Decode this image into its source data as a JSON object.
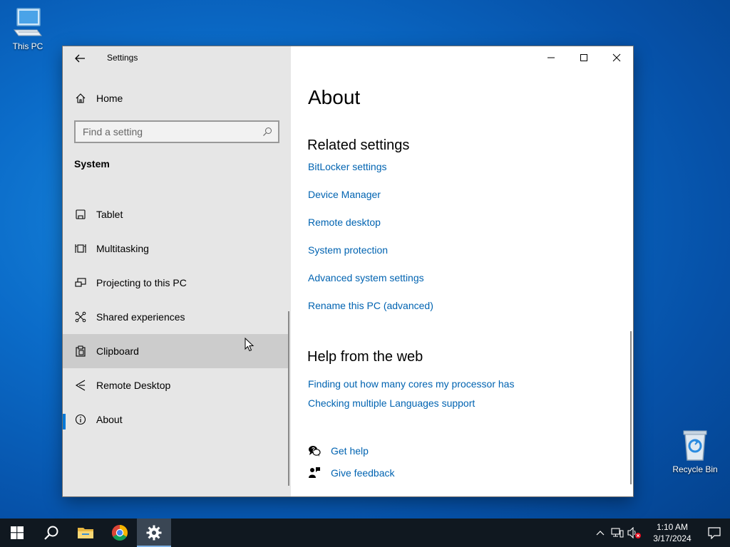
{
  "desktop": {
    "this_pc_label": "This PC",
    "recycle_bin_label": "Recycle Bin"
  },
  "window": {
    "app_title": "Settings",
    "nav": {
      "home_label": "Home",
      "search_placeholder": "Find a setting",
      "section_label": "System",
      "items": [
        {
          "label": "Tablet",
          "icon": "tablet-icon"
        },
        {
          "label": "Multitasking",
          "icon": "multitasking-icon"
        },
        {
          "label": "Projecting to this PC",
          "icon": "projecting-icon"
        },
        {
          "label": "Shared experiences",
          "icon": "shared-experiences-icon"
        },
        {
          "label": "Clipboard",
          "icon": "clipboard-icon"
        },
        {
          "label": "Remote Desktop",
          "icon": "remote-desktop-icon"
        },
        {
          "label": "About",
          "icon": "info-icon"
        }
      ]
    },
    "content": {
      "page_title": "About",
      "related_title": "Related settings",
      "related_links": [
        "BitLocker settings",
        "Device Manager",
        "Remote desktop",
        "System protection",
        "Advanced system settings",
        "Rename this PC (advanced)"
      ],
      "help_title": "Help from the web",
      "help_links": [
        "Finding out how many cores my processor has",
        "Checking multiple Languages support"
      ],
      "get_help_label": "Get help",
      "give_feedback_label": "Give feedback"
    }
  },
  "taskbar": {
    "time": "1:10 AM",
    "date": "3/17/2024"
  },
  "colors": {
    "accent": "#0078d7",
    "link": "#0063b1",
    "nav_bg": "#e6e6e6",
    "taskbar_bg": "#101820"
  }
}
